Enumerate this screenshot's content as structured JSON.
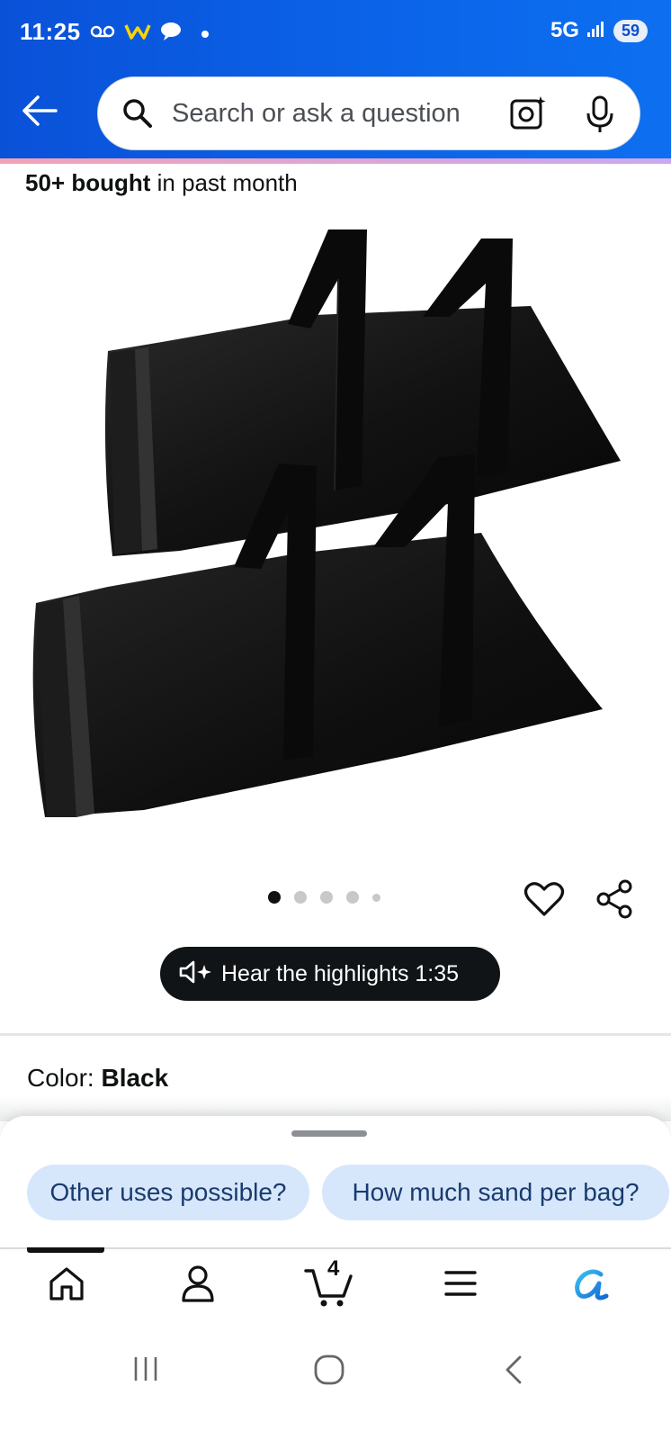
{
  "status_bar": {
    "time": "11:25",
    "network": "5G",
    "battery": "59"
  },
  "search": {
    "placeholder": "Search or ask a question"
  },
  "product": {
    "bought_count": "50+ bought",
    "bought_suffix": " in past month",
    "image_count": 5,
    "active_image_index": 0,
    "hear_highlights": "Hear the highlights 1:35",
    "color_label": "Color: ",
    "color_value": "Black"
  },
  "suggestions": [
    "Other uses possible?",
    "How much sand per bag?"
  ],
  "bottom_nav": {
    "items": [
      "home-icon",
      "account-icon",
      "cart-icon",
      "menu-icon",
      "rufus-icon"
    ],
    "cart_count": "4"
  },
  "colors": {
    "header_blue": "#0b5ee0",
    "chip_bg": "#d6e7fb",
    "pill_bg": "#111416"
  }
}
